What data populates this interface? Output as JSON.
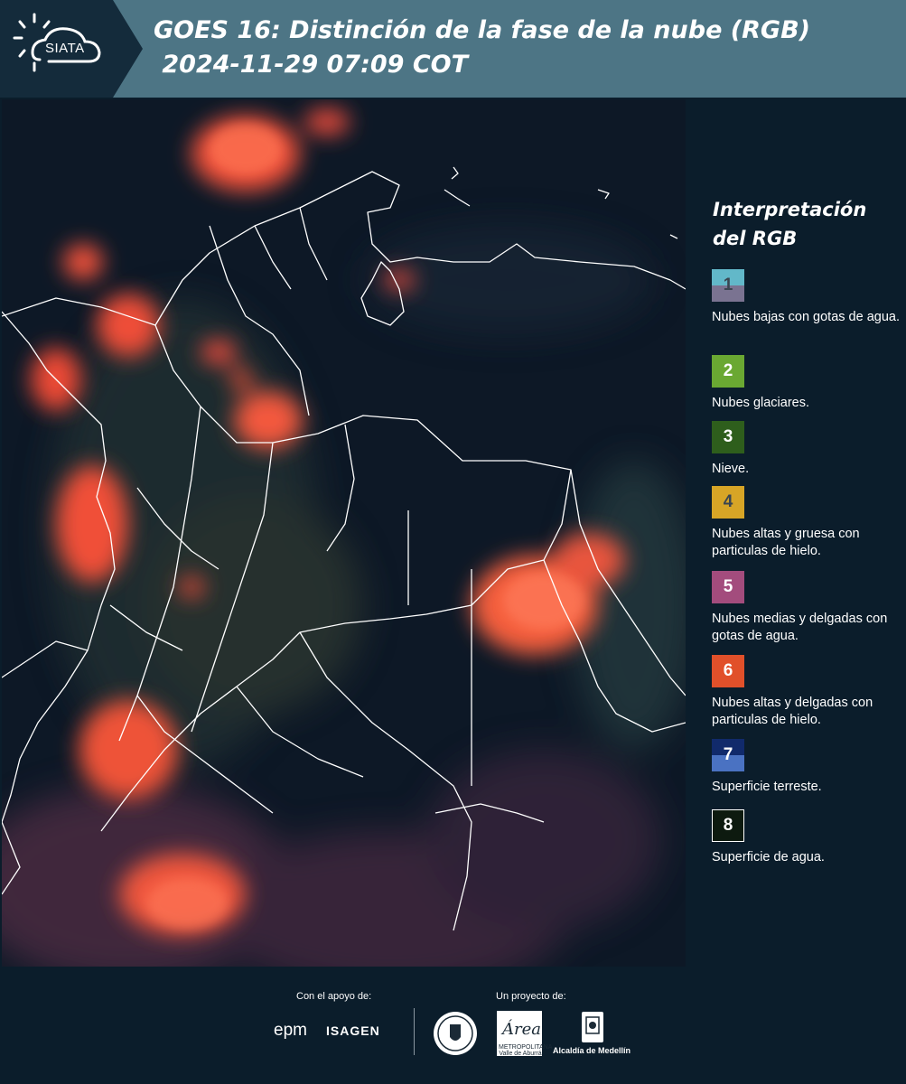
{
  "header": {
    "logo_text": "SIATA",
    "title": "GOES 16: Distinción de la fase de la nube (RGB)\n 2024-11-29 07:09 COT"
  },
  "legend": {
    "title": "Interpretación del RGB",
    "items": [
      {
        "num": "1",
        "label": "Nubes bajas con gotas de agua.",
        "color_top": "#62b8c9",
        "color_bottom": "#7a7391",
        "num_color": "#3a4550"
      },
      {
        "num": "2",
        "label": "Nubes glaciares.",
        "color_top": "#6aa832",
        "color_bottom": "#6aa832",
        "num_color": "#ffffff"
      },
      {
        "num": "3",
        "label": "Nieve.",
        "color_top": "#2e5e1c",
        "color_bottom": "#2e5e1c",
        "num_color": "#ffffff"
      },
      {
        "num": "4",
        "label": "Nubes altas y gruesa con particulas de hielo.",
        "color_top": "#d7a526",
        "color_bottom": "#d7a526",
        "num_color": "#3a4550"
      },
      {
        "num": "5",
        "label": "Nubes medias y delgadas con gotas de agua.",
        "color_top": "#a34c7d",
        "color_bottom": "#a34c7d",
        "num_color": "#ffffff"
      },
      {
        "num": "6",
        "label": "Nubes altas y delgadas con particulas de hielo.",
        "color_top": "#e1502a",
        "color_bottom": "#e1502a",
        "num_color": "#ffffff"
      },
      {
        "num": "7",
        "label": "Superficie terreste.",
        "color_top": "#112a6b",
        "color_bottom": "#4a72c2",
        "num_color": "#ffffff"
      },
      {
        "num": "8",
        "label": "Superficie de agua.",
        "color_top": "#0d1a0f",
        "color_bottom": "#0d1a0f",
        "num_color": "#ffffff"
      }
    ]
  },
  "footer": {
    "support_label": "Con el apoyo de:",
    "project_label": "Un proyecto de:",
    "epm": "epm",
    "isagen": "ISAGEN",
    "area_text": "METROPOLITANA Valle de Aburrá",
    "area_script": "Área",
    "alcaldia": "Alcaldía de Medellín"
  }
}
